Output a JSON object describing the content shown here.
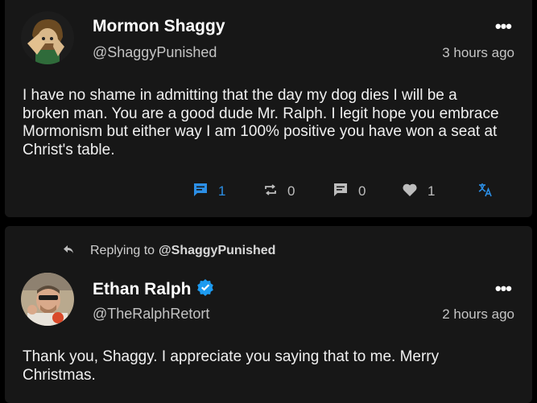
{
  "post1": {
    "author_name": "Mormon Shaggy",
    "author_handle": "@ShaggyPunished",
    "timestamp": "3 hours ago",
    "more_glyph": "•••",
    "text": "I have no shame in admitting that the day my dog dies I will be a broken man. You are a good dude Mr. Ralph. I legit hope you embrace Mormonism but either way I am 100% positive you have won a seat at Christ's table.",
    "actions": {
      "replies": "1",
      "reposts": "0",
      "quotes": "0",
      "likes": "1"
    },
    "icons": [
      "comment-icon",
      "repost-icon",
      "quote-icon",
      "heart-icon",
      "translate-icon"
    ],
    "accent_color": "#2c8fe6"
  },
  "post2": {
    "replying_prefix": "Replying to",
    "replying_to": "@ShaggyPunished",
    "author_name": "Ethan Ralph",
    "verified": true,
    "author_handle": "@TheRalphRetort",
    "timestamp": "2 hours ago",
    "more_glyph": "•••",
    "text": "Thank you, Shaggy. I appreciate you saying that to me. Merry Christmas.",
    "verified_color": "#1d9bf0"
  }
}
